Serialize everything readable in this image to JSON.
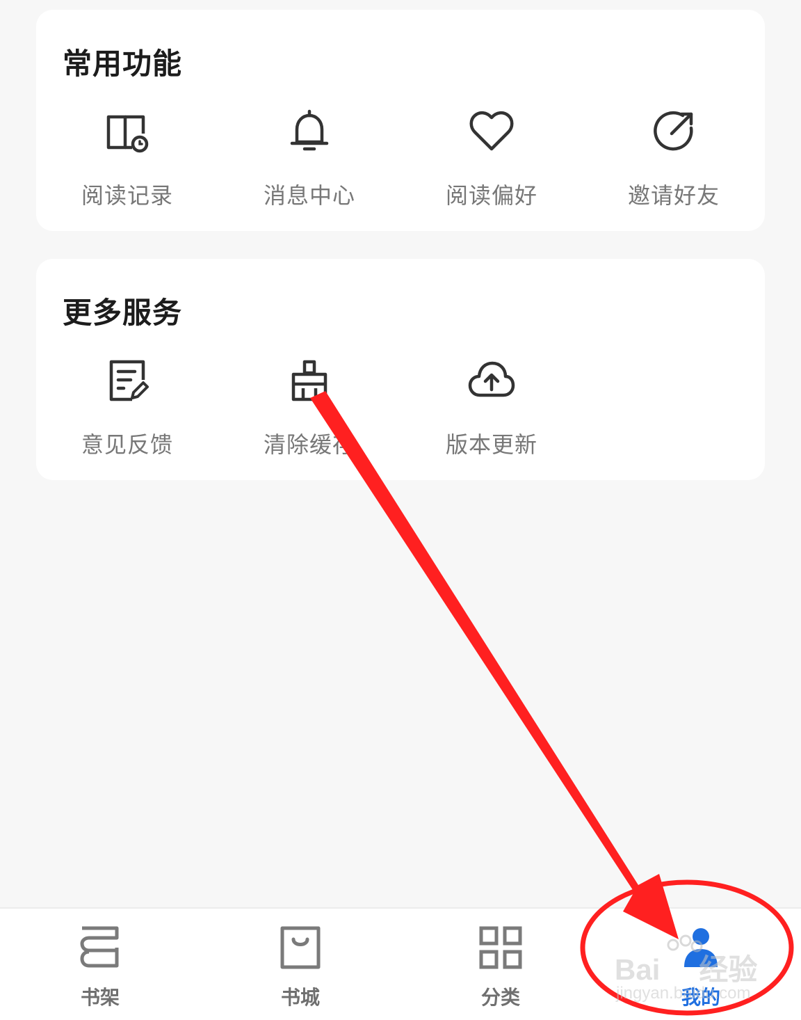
{
  "common_functions": {
    "title": "常用功能",
    "items": [
      {
        "label": "阅读记录",
        "icon": "reading-history-icon"
      },
      {
        "label": "消息中心",
        "icon": "bell-icon"
      },
      {
        "label": "阅读偏好",
        "icon": "heart-icon"
      },
      {
        "label": "邀请好友",
        "icon": "share-icon"
      }
    ]
  },
  "more_services": {
    "title": "更多服务",
    "items": [
      {
        "label": "意见反馈",
        "icon": "feedback-icon"
      },
      {
        "label": "清除缓存",
        "icon": "broom-icon"
      },
      {
        "label": "版本更新",
        "icon": "cloud-upload-icon"
      }
    ]
  },
  "bottom_nav": {
    "items": [
      {
        "label": "书架",
        "icon": "bookshelf-icon",
        "active": false
      },
      {
        "label": "书城",
        "icon": "shopping-bag-icon",
        "active": false
      },
      {
        "label": "分类",
        "icon": "grid-icon",
        "active": false
      },
      {
        "label": "我的",
        "icon": "user-icon",
        "active": true
      }
    ]
  },
  "watermark": {
    "brand": "Bai",
    "brand_suffix": "经验",
    "url": "jingyan.baidu.com"
  },
  "colors": {
    "active": "#1f6fe0",
    "annotation": "#ff2020",
    "icon": "#333333",
    "label": "#777777"
  }
}
